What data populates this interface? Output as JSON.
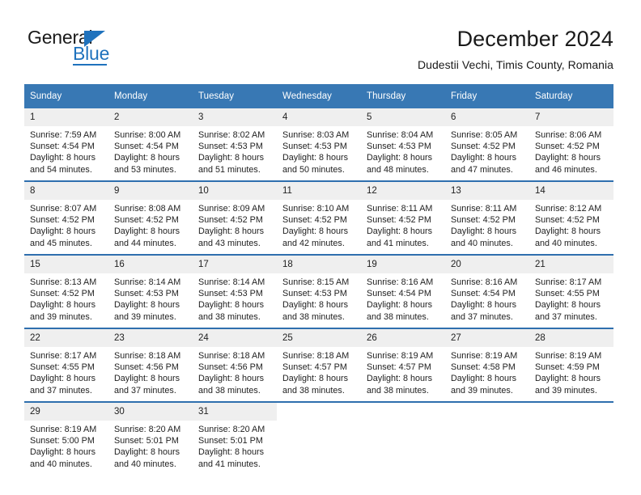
{
  "brand": {
    "name_top": "General",
    "name_bottom": "Blue",
    "accent_color": "#1f72bd"
  },
  "header": {
    "title": "December 2024",
    "subtitle": "Dudestii Vechi, Timis County, Romania"
  },
  "theme": {
    "header_row_bg": "#3878b4",
    "row_divider": "#2f6fae",
    "daynum_bg": "#efefef",
    "text_color": "#222222"
  },
  "weekdays": [
    "Sunday",
    "Monday",
    "Tuesday",
    "Wednesday",
    "Thursday",
    "Friday",
    "Saturday"
  ],
  "weeks": [
    [
      {
        "day": "1",
        "sunrise": "Sunrise: 7:59 AM",
        "sunset": "Sunset: 4:54 PM",
        "daylight_1": "Daylight: 8 hours",
        "daylight_2": "and 54 minutes."
      },
      {
        "day": "2",
        "sunrise": "Sunrise: 8:00 AM",
        "sunset": "Sunset: 4:54 PM",
        "daylight_1": "Daylight: 8 hours",
        "daylight_2": "and 53 minutes."
      },
      {
        "day": "3",
        "sunrise": "Sunrise: 8:02 AM",
        "sunset": "Sunset: 4:53 PM",
        "daylight_1": "Daylight: 8 hours",
        "daylight_2": "and 51 minutes."
      },
      {
        "day": "4",
        "sunrise": "Sunrise: 8:03 AM",
        "sunset": "Sunset: 4:53 PM",
        "daylight_1": "Daylight: 8 hours",
        "daylight_2": "and 50 minutes."
      },
      {
        "day": "5",
        "sunrise": "Sunrise: 8:04 AM",
        "sunset": "Sunset: 4:53 PM",
        "daylight_1": "Daylight: 8 hours",
        "daylight_2": "and 48 minutes."
      },
      {
        "day": "6",
        "sunrise": "Sunrise: 8:05 AM",
        "sunset": "Sunset: 4:52 PM",
        "daylight_1": "Daylight: 8 hours",
        "daylight_2": "and 47 minutes."
      },
      {
        "day": "7",
        "sunrise": "Sunrise: 8:06 AM",
        "sunset": "Sunset: 4:52 PM",
        "daylight_1": "Daylight: 8 hours",
        "daylight_2": "and 46 minutes."
      }
    ],
    [
      {
        "day": "8",
        "sunrise": "Sunrise: 8:07 AM",
        "sunset": "Sunset: 4:52 PM",
        "daylight_1": "Daylight: 8 hours",
        "daylight_2": "and 45 minutes."
      },
      {
        "day": "9",
        "sunrise": "Sunrise: 8:08 AM",
        "sunset": "Sunset: 4:52 PM",
        "daylight_1": "Daylight: 8 hours",
        "daylight_2": "and 44 minutes."
      },
      {
        "day": "10",
        "sunrise": "Sunrise: 8:09 AM",
        "sunset": "Sunset: 4:52 PM",
        "daylight_1": "Daylight: 8 hours",
        "daylight_2": "and 43 minutes."
      },
      {
        "day": "11",
        "sunrise": "Sunrise: 8:10 AM",
        "sunset": "Sunset: 4:52 PM",
        "daylight_1": "Daylight: 8 hours",
        "daylight_2": "and 42 minutes."
      },
      {
        "day": "12",
        "sunrise": "Sunrise: 8:11 AM",
        "sunset": "Sunset: 4:52 PM",
        "daylight_1": "Daylight: 8 hours",
        "daylight_2": "and 41 minutes."
      },
      {
        "day": "13",
        "sunrise": "Sunrise: 8:11 AM",
        "sunset": "Sunset: 4:52 PM",
        "daylight_1": "Daylight: 8 hours",
        "daylight_2": "and 40 minutes."
      },
      {
        "day": "14",
        "sunrise": "Sunrise: 8:12 AM",
        "sunset": "Sunset: 4:52 PM",
        "daylight_1": "Daylight: 8 hours",
        "daylight_2": "and 40 minutes."
      }
    ],
    [
      {
        "day": "15",
        "sunrise": "Sunrise: 8:13 AM",
        "sunset": "Sunset: 4:52 PM",
        "daylight_1": "Daylight: 8 hours",
        "daylight_2": "and 39 minutes."
      },
      {
        "day": "16",
        "sunrise": "Sunrise: 8:14 AM",
        "sunset": "Sunset: 4:53 PM",
        "daylight_1": "Daylight: 8 hours",
        "daylight_2": "and 39 minutes."
      },
      {
        "day": "17",
        "sunrise": "Sunrise: 8:14 AM",
        "sunset": "Sunset: 4:53 PM",
        "daylight_1": "Daylight: 8 hours",
        "daylight_2": "and 38 minutes."
      },
      {
        "day": "18",
        "sunrise": "Sunrise: 8:15 AM",
        "sunset": "Sunset: 4:53 PM",
        "daylight_1": "Daylight: 8 hours",
        "daylight_2": "and 38 minutes."
      },
      {
        "day": "19",
        "sunrise": "Sunrise: 8:16 AM",
        "sunset": "Sunset: 4:54 PM",
        "daylight_1": "Daylight: 8 hours",
        "daylight_2": "and 38 minutes."
      },
      {
        "day": "20",
        "sunrise": "Sunrise: 8:16 AM",
        "sunset": "Sunset: 4:54 PM",
        "daylight_1": "Daylight: 8 hours",
        "daylight_2": "and 37 minutes."
      },
      {
        "day": "21",
        "sunrise": "Sunrise: 8:17 AM",
        "sunset": "Sunset: 4:55 PM",
        "daylight_1": "Daylight: 8 hours",
        "daylight_2": "and 37 minutes."
      }
    ],
    [
      {
        "day": "22",
        "sunrise": "Sunrise: 8:17 AM",
        "sunset": "Sunset: 4:55 PM",
        "daylight_1": "Daylight: 8 hours",
        "daylight_2": "and 37 minutes."
      },
      {
        "day": "23",
        "sunrise": "Sunrise: 8:18 AM",
        "sunset": "Sunset: 4:56 PM",
        "daylight_1": "Daylight: 8 hours",
        "daylight_2": "and 37 minutes."
      },
      {
        "day": "24",
        "sunrise": "Sunrise: 8:18 AM",
        "sunset": "Sunset: 4:56 PM",
        "daylight_1": "Daylight: 8 hours",
        "daylight_2": "and 38 minutes."
      },
      {
        "day": "25",
        "sunrise": "Sunrise: 8:18 AM",
        "sunset": "Sunset: 4:57 PM",
        "daylight_1": "Daylight: 8 hours",
        "daylight_2": "and 38 minutes."
      },
      {
        "day": "26",
        "sunrise": "Sunrise: 8:19 AM",
        "sunset": "Sunset: 4:57 PM",
        "daylight_1": "Daylight: 8 hours",
        "daylight_2": "and 38 minutes."
      },
      {
        "day": "27",
        "sunrise": "Sunrise: 8:19 AM",
        "sunset": "Sunset: 4:58 PM",
        "daylight_1": "Daylight: 8 hours",
        "daylight_2": "and 39 minutes."
      },
      {
        "day": "28",
        "sunrise": "Sunrise: 8:19 AM",
        "sunset": "Sunset: 4:59 PM",
        "daylight_1": "Daylight: 8 hours",
        "daylight_2": "and 39 minutes."
      }
    ],
    [
      {
        "day": "29",
        "sunrise": "Sunrise: 8:19 AM",
        "sunset": "Sunset: 5:00 PM",
        "daylight_1": "Daylight: 8 hours",
        "daylight_2": "and 40 minutes."
      },
      {
        "day": "30",
        "sunrise": "Sunrise: 8:20 AM",
        "sunset": "Sunset: 5:01 PM",
        "daylight_1": "Daylight: 8 hours",
        "daylight_2": "and 40 minutes."
      },
      {
        "day": "31",
        "sunrise": "Sunrise: 8:20 AM",
        "sunset": "Sunset: 5:01 PM",
        "daylight_1": "Daylight: 8 hours",
        "daylight_2": "and 41 minutes."
      },
      {
        "day": "",
        "sunrise": "",
        "sunset": "",
        "daylight_1": "",
        "daylight_2": ""
      },
      {
        "day": "",
        "sunrise": "",
        "sunset": "",
        "daylight_1": "",
        "daylight_2": ""
      },
      {
        "day": "",
        "sunrise": "",
        "sunset": "",
        "daylight_1": "",
        "daylight_2": ""
      },
      {
        "day": "",
        "sunrise": "",
        "sunset": "",
        "daylight_1": "",
        "daylight_2": ""
      }
    ]
  ]
}
